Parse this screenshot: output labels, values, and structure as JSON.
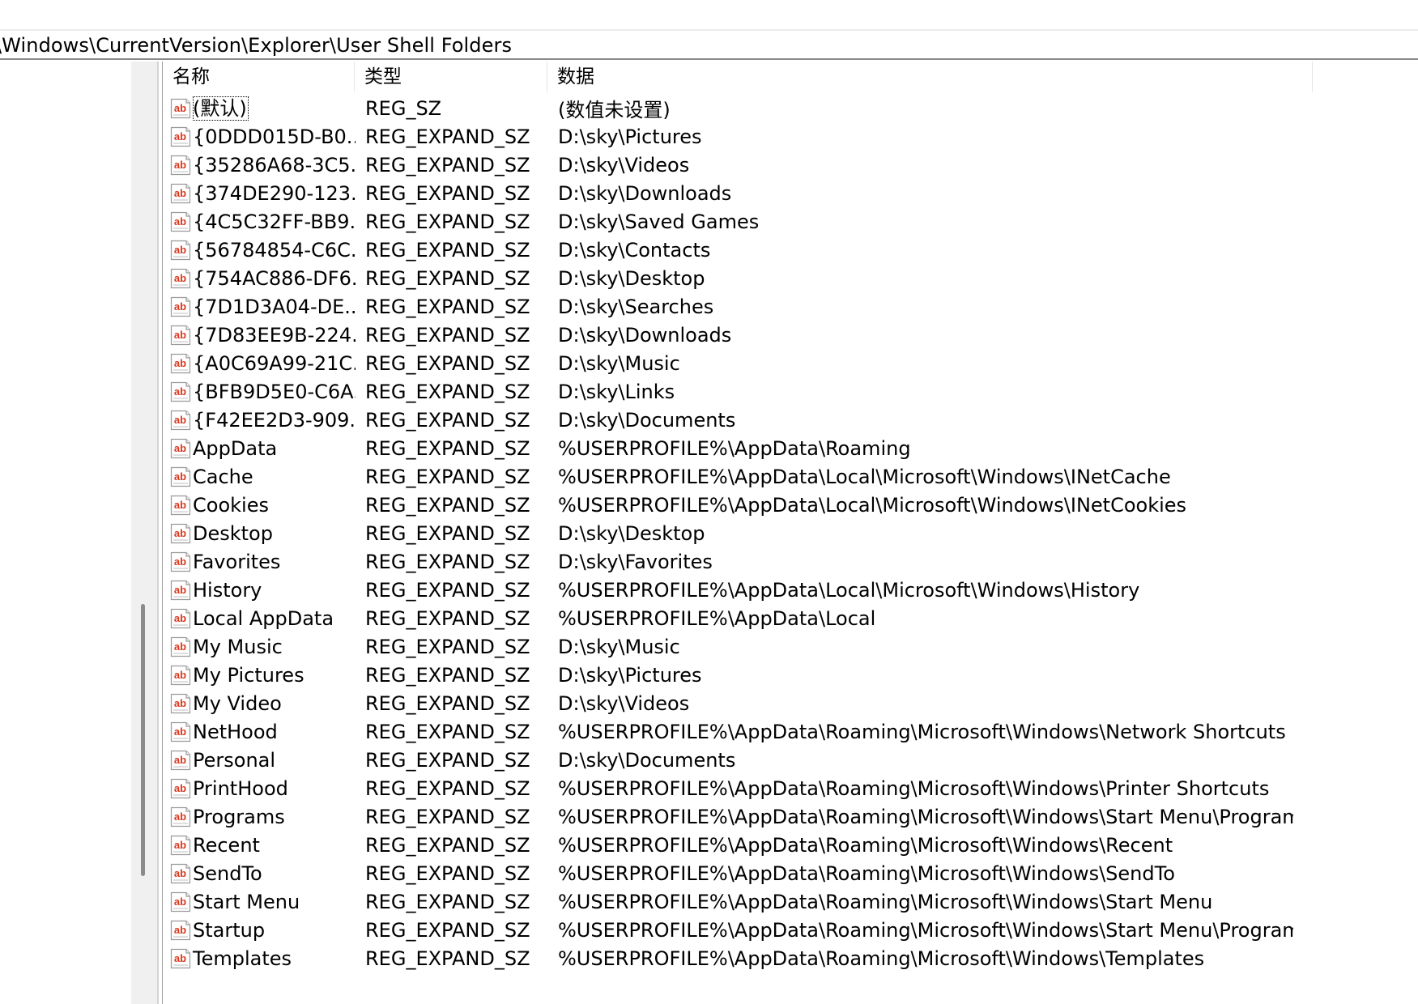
{
  "address": {
    "path": "\\Windows\\CurrentVersion\\Explorer\\User Shell Folders"
  },
  "columns": {
    "name": "名称",
    "type": "类型",
    "data": "数据"
  },
  "rows": [
    {
      "name": "(默认)",
      "type": "REG_SZ",
      "data": "(数值未设置)"
    },
    {
      "name": "{0DDD015D-B0...",
      "type": "REG_EXPAND_SZ",
      "data": "D:\\sky\\Pictures"
    },
    {
      "name": "{35286A68-3C5...",
      "type": "REG_EXPAND_SZ",
      "data": "D:\\sky\\Videos"
    },
    {
      "name": "{374DE290-123...",
      "type": "REG_EXPAND_SZ",
      "data": "D:\\sky\\Downloads"
    },
    {
      "name": "{4C5C32FF-BB9...",
      "type": "REG_EXPAND_SZ",
      "data": "D:\\sky\\Saved Games"
    },
    {
      "name": "{56784854-C6C...",
      "type": "REG_EXPAND_SZ",
      "data": "D:\\sky\\Contacts"
    },
    {
      "name": "{754AC886-DF6...",
      "type": "REG_EXPAND_SZ",
      "data": "D:\\sky\\Desktop"
    },
    {
      "name": "{7D1D3A04-DE...",
      "type": "REG_EXPAND_SZ",
      "data": "D:\\sky\\Searches"
    },
    {
      "name": "{7D83EE9B-224...",
      "type": "REG_EXPAND_SZ",
      "data": "D:\\sky\\Downloads"
    },
    {
      "name": "{A0C69A99-21C...",
      "type": "REG_EXPAND_SZ",
      "data": "D:\\sky\\Music"
    },
    {
      "name": "{BFB9D5E0-C6A...",
      "type": "REG_EXPAND_SZ",
      "data": "D:\\sky\\Links"
    },
    {
      "name": "{F42EE2D3-909...",
      "type": "REG_EXPAND_SZ",
      "data": "D:\\sky\\Documents"
    },
    {
      "name": "AppData",
      "type": "REG_EXPAND_SZ",
      "data": "%USERPROFILE%\\AppData\\Roaming"
    },
    {
      "name": "Cache",
      "type": "REG_EXPAND_SZ",
      "data": "%USERPROFILE%\\AppData\\Local\\Microsoft\\Windows\\INetCache"
    },
    {
      "name": "Cookies",
      "type": "REG_EXPAND_SZ",
      "data": "%USERPROFILE%\\AppData\\Local\\Microsoft\\Windows\\INetCookies"
    },
    {
      "name": "Desktop",
      "type": "REG_EXPAND_SZ",
      "data": "D:\\sky\\Desktop"
    },
    {
      "name": "Favorites",
      "type": "REG_EXPAND_SZ",
      "data": "D:\\sky\\Favorites"
    },
    {
      "name": "History",
      "type": "REG_EXPAND_SZ",
      "data": "%USERPROFILE%\\AppData\\Local\\Microsoft\\Windows\\History"
    },
    {
      "name": "Local AppData",
      "type": "REG_EXPAND_SZ",
      "data": "%USERPROFILE%\\AppData\\Local"
    },
    {
      "name": "My Music",
      "type": "REG_EXPAND_SZ",
      "data": "D:\\sky\\Music"
    },
    {
      "name": "My Pictures",
      "type": "REG_EXPAND_SZ",
      "data": "D:\\sky\\Pictures"
    },
    {
      "name": "My Video",
      "type": "REG_EXPAND_SZ",
      "data": "D:\\sky\\Videos"
    },
    {
      "name": "NetHood",
      "type": "REG_EXPAND_SZ",
      "data": "%USERPROFILE%\\AppData\\Roaming\\Microsoft\\Windows\\Network Shortcuts"
    },
    {
      "name": "Personal",
      "type": "REG_EXPAND_SZ",
      "data": "D:\\sky\\Documents"
    },
    {
      "name": "PrintHood",
      "type": "REG_EXPAND_SZ",
      "data": "%USERPROFILE%\\AppData\\Roaming\\Microsoft\\Windows\\Printer Shortcuts"
    },
    {
      "name": "Programs",
      "type": "REG_EXPAND_SZ",
      "data": "%USERPROFILE%\\AppData\\Roaming\\Microsoft\\Windows\\Start Menu\\Programs"
    },
    {
      "name": "Recent",
      "type": "REG_EXPAND_SZ",
      "data": "%USERPROFILE%\\AppData\\Roaming\\Microsoft\\Windows\\Recent"
    },
    {
      "name": "SendTo",
      "type": "REG_EXPAND_SZ",
      "data": "%USERPROFILE%\\AppData\\Roaming\\Microsoft\\Windows\\SendTo"
    },
    {
      "name": "Start Menu",
      "type": "REG_EXPAND_SZ",
      "data": "%USERPROFILE%\\AppData\\Roaming\\Microsoft\\Windows\\Start Menu"
    },
    {
      "name": "Startup",
      "type": "REG_EXPAND_SZ",
      "data": "%USERPROFILE%\\AppData\\Roaming\\Microsoft\\Windows\\Start Menu\\Program..."
    },
    {
      "name": "Templates",
      "type": "REG_EXPAND_SZ",
      "data": "%USERPROFILE%\\AppData\\Roaming\\Microsoft\\Windows\\Templates"
    }
  ],
  "icons": {
    "row_icon": "string-value-icon",
    "icon_text": "ab",
    "icon_color": "#d9381e"
  },
  "tree_scrollbar": {
    "thumb_color": "#8b8b8b"
  }
}
